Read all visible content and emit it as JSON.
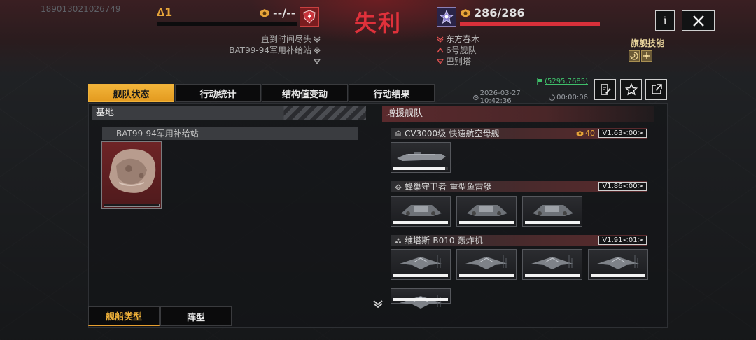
{
  "account_id": "189013021026749",
  "result": "失利",
  "left_team": {
    "rank": "∆1",
    "score": "--/--",
    "info": [
      "直到时间尽头",
      "BAT99-94军用补给站",
      "--"
    ]
  },
  "right_team": {
    "score": "286/286",
    "hp_fraction": 1.0,
    "info": [
      "东方春木",
      "6号舰队",
      "巴别塔"
    ]
  },
  "flagship_skill_label": "旗舰技能",
  "info_button": "i",
  "tabs": [
    "舰队状态",
    "行动统计",
    "结构值变动",
    "行动结果"
  ],
  "active_tab": 0,
  "coordinates": "(5295,7685)",
  "timestamp": "2026-03-27 10:42:36",
  "duration": "00:00:06",
  "base": {
    "header": "基地",
    "station_name": "BAT99-94军用补给站"
  },
  "reinforcements": {
    "header": "增援舰队",
    "groups": [
      {
        "name": "CV3000级-快速航空母舰",
        "cost": "40",
        "version": "V1.63<00>",
        "ships": [
          0.95
        ]
      },
      {
        "name": "蜂巢守卫者-重型鱼雷艇",
        "cost": "",
        "version": "V1.86<00>",
        "ships": [
          1.0,
          1.0,
          1.0
        ]
      },
      {
        "name": "维塔斯-B010-轰炸机",
        "cost": "",
        "version": "V1.91<01>",
        "ships": [
          1.0,
          1.0,
          1.0,
          1.0,
          1.0
        ]
      }
    ]
  },
  "bottom_tabs": [
    "舰船类型",
    "阵型"
  ],
  "active_bottom_tab": 0,
  "colors": {
    "accent": "#f0b23a",
    "defeat": "#e0313b",
    "hp_bar": "#d8303a",
    "coord": "#3fbf6a"
  }
}
